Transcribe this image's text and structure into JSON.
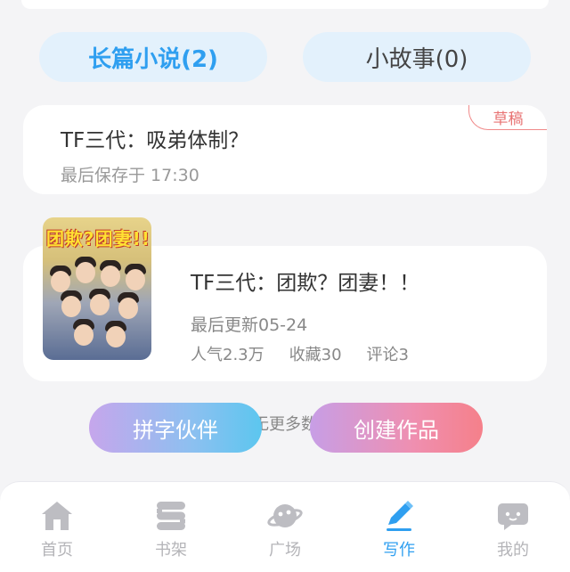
{
  "tabs": {
    "long": {
      "label": "长篇小说(2)"
    },
    "short": {
      "label": "小故事(0)"
    }
  },
  "draft": {
    "title": "TF三代：吸弟体制？",
    "saved_time": "最后保存于 17:30",
    "badge": "草稿"
  },
  "work": {
    "cover_text": "团欺?团妻!!",
    "title": "TF三代：团欺？团妻！！",
    "updated": "最后更新05-24",
    "stats": {
      "popularity": "人气2.3万",
      "favorites": "收藏30",
      "comments": "评论3"
    }
  },
  "list_end": "无更多数",
  "actions": {
    "partner": "拼字伙伴",
    "create": "创建作品"
  },
  "nav": {
    "items": [
      {
        "label": "首页",
        "icon": "home-icon"
      },
      {
        "label": "书架",
        "icon": "bookshelf-icon"
      },
      {
        "label": "广场",
        "icon": "planet-icon"
      },
      {
        "label": "写作",
        "icon": "pen-icon"
      },
      {
        "label": "我的",
        "icon": "chat-bubble-icon"
      }
    ],
    "active_index": 3
  },
  "colors": {
    "accent_blue": "#2f9ff0",
    "draft_red": "#e87373",
    "nav_inactive": "#b4b4b8",
    "tab_bg": "#e3f1fc"
  }
}
